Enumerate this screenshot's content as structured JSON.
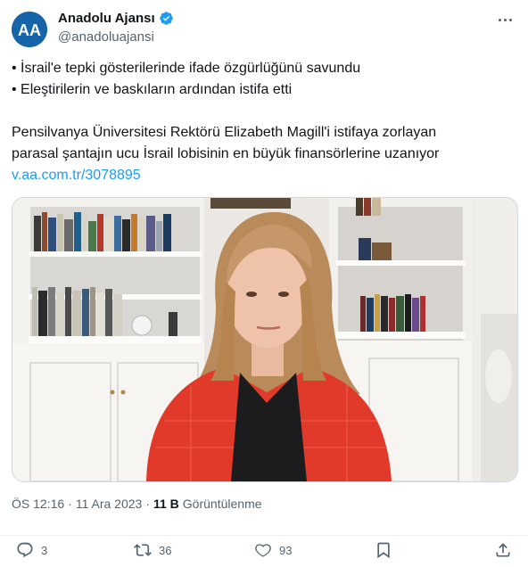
{
  "account": {
    "name": "Anadolu Ajansı",
    "handle": "@anadoluajansi",
    "avatar_text": "AA",
    "brand_color": "#1565a8"
  },
  "tweet": {
    "bullet1": "• İsrail'e tepki gösterilerinde ifade özgürlüğünü savundu",
    "bullet2": "• Eleştirilerin ve baskıların ardından istifa etti",
    "para_line1": "Pensilvanya Üniversitesi Rektörü Elizabeth Magill'i istifaya zorlayan",
    "para_line2": "parasal şantajın ucu İsrail lobisinin en büyük finansörlerine uzanıyor",
    "link": "v.aa.com.tr/3078895"
  },
  "meta": {
    "time": "ÖS 12:16",
    "separator": "·",
    "date": "11 Ara 2023",
    "separator2": "·",
    "views": "11 B",
    "views_label": "Görüntülenme"
  },
  "actions": {
    "replies": "3",
    "reposts": "36",
    "likes": "93"
  },
  "icons": [
    "verified-badge-icon",
    "more-icon",
    "reply-icon",
    "repost-icon",
    "like-icon",
    "bookmark-icon",
    "share-icon"
  ],
  "colors": {
    "link": "#1d9bf0",
    "muted": "#536471",
    "verified": "#1d9bf0"
  }
}
